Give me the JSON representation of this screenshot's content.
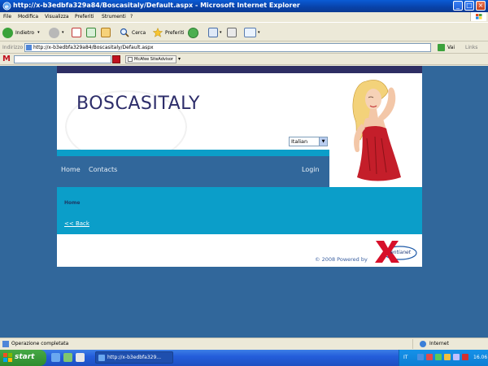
{
  "window": {
    "title": "http://x-b3edbfa329a84/Boscasitaly/Default.aspx - Microsoft Internet Explorer",
    "minimize": "_",
    "maximize": "□",
    "close": "×"
  },
  "menu": {
    "items": [
      "File",
      "Modifica",
      "Visualizza",
      "Preferiti",
      "Strumenti",
      "?"
    ]
  },
  "toolbar": {
    "back_label": "Indietro",
    "search_label": "Cerca",
    "favorites_label": "Preferiti"
  },
  "address": {
    "label": "Indirizzo",
    "url": "http://x-b3edbfa329a84/Boscasitaly/Default.aspx",
    "go_label": "Vai",
    "links_label": "Links"
  },
  "mcafee": {
    "logo": "M",
    "siteadvisor_label": "McAfee SiteAdvisor",
    "dropdown": "▾"
  },
  "site": {
    "brand": "BOSCASITALY",
    "language": "Italian",
    "nav": {
      "home": "Home",
      "contacts": "Contacts",
      "login": "Login"
    },
    "breadcrumb": "Home",
    "back_link": "<< Back",
    "footer_text": "© 2008 Powered by",
    "footer_logo_text": "entianet",
    "colors": {
      "header_strip": "#2e2e63",
      "accent_cyan": "#0b9ec9",
      "nav_blue": "#31679b",
      "brand_text": "#2d2d6a"
    }
  },
  "status": {
    "message": "Operazione completata",
    "zone": "Internet"
  },
  "taskbar": {
    "start_label": "start",
    "task_label": "http://x-b3edbfa329...",
    "language": "IT",
    "clock": "16.06"
  }
}
